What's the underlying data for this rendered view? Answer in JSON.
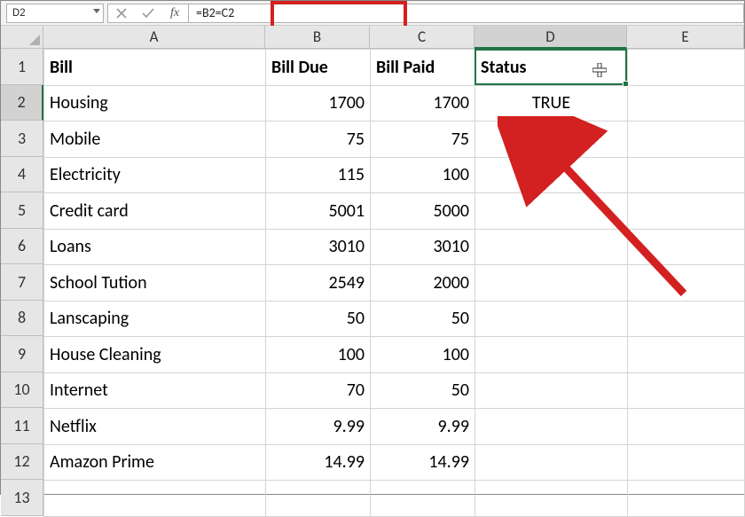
{
  "namebox": "D2",
  "formula": "=B2=C2",
  "columns": [
    "A",
    "B",
    "C",
    "D",
    "E"
  ],
  "activeCol": "D",
  "activeRowIdx": 1,
  "headers": {
    "A": "Bill",
    "B": "Bill Due",
    "C": "Bill Paid",
    "D": "Status"
  },
  "rows": [
    {
      "n": "1"
    },
    {
      "n": "2",
      "A": "Housing",
      "B": "1700",
      "C": "1700",
      "D": "TRUE"
    },
    {
      "n": "3",
      "A": "Mobile",
      "B": "75",
      "C": "75"
    },
    {
      "n": "4",
      "A": "Electricity",
      "B": "115",
      "C": "100"
    },
    {
      "n": "5",
      "A": "Credit card",
      "B": "5001",
      "C": "5000"
    },
    {
      "n": "6",
      "A": "Loans",
      "B": "3010",
      "C": "3010"
    },
    {
      "n": "7",
      "A": "School Tution",
      "B": "2549",
      "C": "2000"
    },
    {
      "n": "8",
      "A": "Lanscaping",
      "B": "50",
      "C": "50"
    },
    {
      "n": "9",
      "A": "House Cleaning",
      "B": "100",
      "C": "100"
    },
    {
      "n": "10",
      "A": "Internet",
      "B": "70",
      "C": "50"
    },
    {
      "n": "11",
      "A": "Netflix",
      "B": "9.99",
      "C": "9.99"
    },
    {
      "n": "12",
      "A": "Amazon Prime",
      "B": "14.99",
      "C": "14.99"
    },
    {
      "n": "13"
    }
  ],
  "chart_data": {
    "type": "table",
    "columns": [
      "Bill",
      "Bill Due",
      "Bill Paid",
      "Status"
    ],
    "rows": [
      [
        "Housing",
        1700,
        1700,
        "TRUE"
      ],
      [
        "Mobile",
        75,
        75,
        null
      ],
      [
        "Electricity",
        115,
        100,
        null
      ],
      [
        "Credit card",
        5001,
        5000,
        null
      ],
      [
        "Loans",
        3010,
        3010,
        null
      ],
      [
        "School Tution",
        2549,
        2000,
        null
      ],
      [
        "Lanscaping",
        50,
        50,
        null
      ],
      [
        "House Cleaning",
        100,
        100,
        null
      ],
      [
        "Internet",
        70,
        50,
        null
      ],
      [
        "Netflix",
        9.99,
        9.99,
        null
      ],
      [
        "Amazon Prime",
        14.99,
        14.99,
        null
      ]
    ]
  }
}
